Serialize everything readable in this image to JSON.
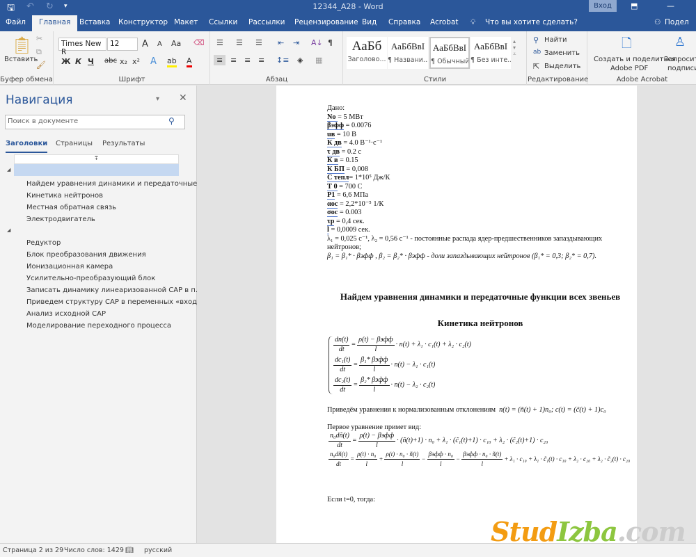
{
  "window": {
    "title": "12344_A28  -  Word",
    "sign_in": "Вход"
  },
  "tabs": [
    "Файл",
    "Главная",
    "Вставка",
    "Конструктор",
    "Макет",
    "Ссылки",
    "Рассылки",
    "Рецензирование",
    "Вид",
    "Справка",
    "Acrobat"
  ],
  "tell_me": "Что вы хотите сделать?",
  "share": "Подел",
  "ribbon": {
    "clipboard": {
      "paste": "Вставить",
      "label": "Буфер обмена"
    },
    "font": {
      "name": "Times New R",
      "size": "12",
      "grow": "A",
      "shrink": "A",
      "case": "Aa",
      "bold": "Ж",
      "italic": "К",
      "underline": "Ч",
      "strike": "abc",
      "sub": "x₂",
      "sup": "x²",
      "label": "Шрифт"
    },
    "paragraph": {
      "label": "Абзац",
      "pilcrow": "¶"
    },
    "styles": {
      "label": "Стили",
      "items": [
        {
          "sample": "АаБб",
          "name": "Заголово..."
        },
        {
          "sample": "АаБбВвI",
          "name": "¶ Названи..."
        },
        {
          "sample": "АаБбВвI",
          "name": "¶ Обычный"
        },
        {
          "sample": "АаБбВвI",
          "name": "¶ Без инте..."
        }
      ]
    },
    "editing": {
      "find": "Найти",
      "replace": "Заменить",
      "select": "Выделить",
      "label": "Редактирование"
    },
    "acrobat": {
      "create": "Создать и поделиться",
      "create2": "Adobe PDF",
      "request": "Запросить",
      "request2": "подписи",
      "label": "Adobe Acrobat"
    }
  },
  "nav": {
    "title": "Навигация",
    "search_placeholder": "Поиск в документе",
    "tabs": [
      "Заголовки",
      "Страницы",
      "Результаты"
    ],
    "group1": [
      "Найдем уравнения динамики и передаточные...",
      "Кинетика нейтронов",
      "Местная обратная связь",
      "Электродвигатель"
    ],
    "group2": [
      "Редуктор",
      "Блок преобразования движения",
      "Ионизационная камера",
      "Усилительно-преобразующий блок",
      "Записать динамику линеаризованной САР в п...",
      "Приведем структуру САР в переменных «вход...",
      "Анализ исходной САР",
      "Моделирование переходного процесса"
    ]
  },
  "doc": {
    "given": "Дано:",
    "params": [
      {
        "k": "No ",
        "v": " = 5 МВт"
      },
      {
        "k": "βэфф",
        "v": " =  0.0076"
      },
      {
        "k": "uв",
        "v": " = 10 В"
      },
      {
        "k": "К дв",
        "v": " =  4.0   В⁻¹·с⁻¹"
      },
      {
        "k": "τ дв",
        "v": " = 0.2  с"
      },
      {
        "k": "К в",
        "v": " = 0.15"
      },
      {
        "k": "К БП",
        "v": " = 0,008"
      },
      {
        "k": "С тепл",
        "v": "= 1*10⁵ Дж/К"
      },
      {
        "k": "Т 0",
        "v": " = 700 С"
      },
      {
        "k": "Р1",
        "v": " = 6,6 МПа"
      },
      {
        "k": "αос",
        "v": " = 2,2*10⁻⁵  1/К"
      },
      {
        "k": "σос",
        "v": " = 0.003"
      },
      {
        "k": "τр",
        "v": " = 0,4 сек."
      },
      {
        "k": "l",
        "v": " = 0,0009 сек."
      }
    ],
    "lambda_line": "λ₁ = 0,025 с⁻¹, λ₂ = 0,56 с⁻¹ -  постоянные распада ядер-предшественников запаздывающих нейтронов;",
    "beta_line": "β₁ = β₁* · βэфф ,  β₂ = β₂* · βэфф  - доли запаздывающих нейтронов (β₁* = 0,3;  β₂* = 0,7).",
    "heading1": "Найдем уравнения динамики и передаточные функции всех звеньев",
    "heading2": "Кинетика нейтронов",
    "system": [
      {
        "ln": "dn(t)",
        "ld": "dt",
        "rn": "ρ(t) − βэфф",
        "rd": "l",
        "tail": "· n(t) + λ₁ · c₁(t) + λ₂ · c₂(t)"
      },
      {
        "ln": "dc₁(t)",
        "ld": "dt",
        "rn": "β₁* βэфф",
        "rd": "l",
        "tail": "· n(t) − λ₁ · c₁(t)"
      },
      {
        "ln": "dc₂(t)",
        "ld": "dt",
        "rn": "β₂* βэфф",
        "rd": "l",
        "tail": "· n(t) − λ₂ · c₂(t)"
      }
    ],
    "normalize_text": "Приведём уравнения к нормализованным отклонениям",
    "normalize_eq": "n(t) = (ñ(t) + 1)n₀; c(t) = (c̃(t) + 1)c₀",
    "first_eq_text": "Первое уравнение примет вид:",
    "eq_a": {
      "ln": "n₀dñ(t)",
      "ld": "dt",
      "rn": "ρ(t) − βэфф",
      "rd": "l",
      "tail": "· (ñ(t)+1) · n₀ + λ₁ · (c̃₁(t)+1) · c₁₀ + λ₂ · (c̃₂(t)+1) · c₂₀"
    },
    "eq_b": {
      "ln": "n₀dñ(t)",
      "ld": "dt",
      "f": [
        {
          "n": "ρ(t) · n₀",
          "d": "l",
          "op": "+"
        },
        {
          "n": "ρ(t) · n₀ · ñ(t)",
          "d": "l",
          "op": "−"
        },
        {
          "n": "βэфф · n₀",
          "d": "l",
          "op": "−"
        },
        {
          "n": "βэфф · n₀ · ñ(t)",
          "d": "l",
          "op": ""
        }
      ],
      "tail": "+ λ₁ · c₁₀ + λ₁ · c̃₁(t) · c₁₀ + λ₂ · c₂₀ + λ₂ · c̃₂(t) · c₂₀"
    },
    "if_t0": "Если t=0, тогда:"
  },
  "status": {
    "page": "Страница 2 из 29",
    "words": "Число слов: 1429",
    "lang": "русский"
  },
  "watermark": {
    "part1": "Stud",
    "part2": "Izba",
    ".com": ".com"
  }
}
